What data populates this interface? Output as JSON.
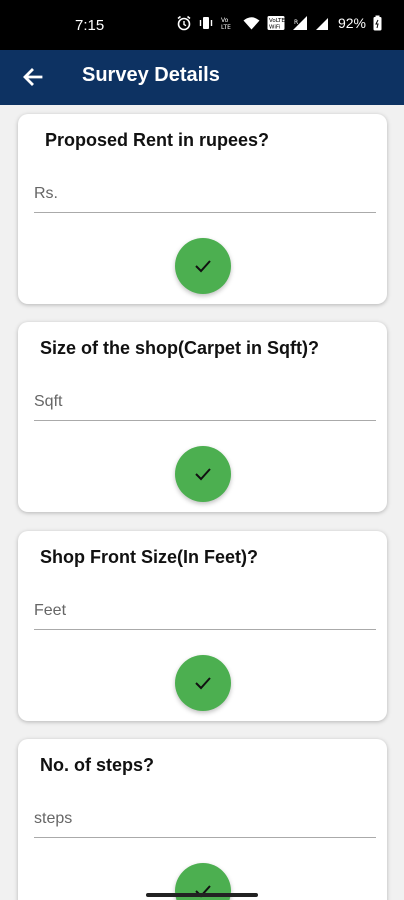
{
  "status_bar": {
    "time": "7:15",
    "battery": "92%"
  },
  "app_bar": {
    "title": "Survey Details",
    "back_icon": "arrow-back-icon"
  },
  "colors": {
    "app_bar": "#0d3262",
    "check_button": "#4caf50"
  },
  "questions": [
    {
      "label": "Proposed Rent in rupees?",
      "placeholder": "Rs.",
      "value": "",
      "button_icon": "check-icon"
    },
    {
      "label": "Size of the shop(Carpet in Sqft)?",
      "placeholder": "Sqft",
      "value": "",
      "button_icon": "check-icon"
    },
    {
      "label": "Shop Front Size(In Feet)?",
      "placeholder": "Feet",
      "value": "",
      "button_icon": "check-icon"
    },
    {
      "label": "No. of steps?",
      "placeholder": "steps",
      "value": "",
      "button_icon": "check-icon"
    }
  ]
}
